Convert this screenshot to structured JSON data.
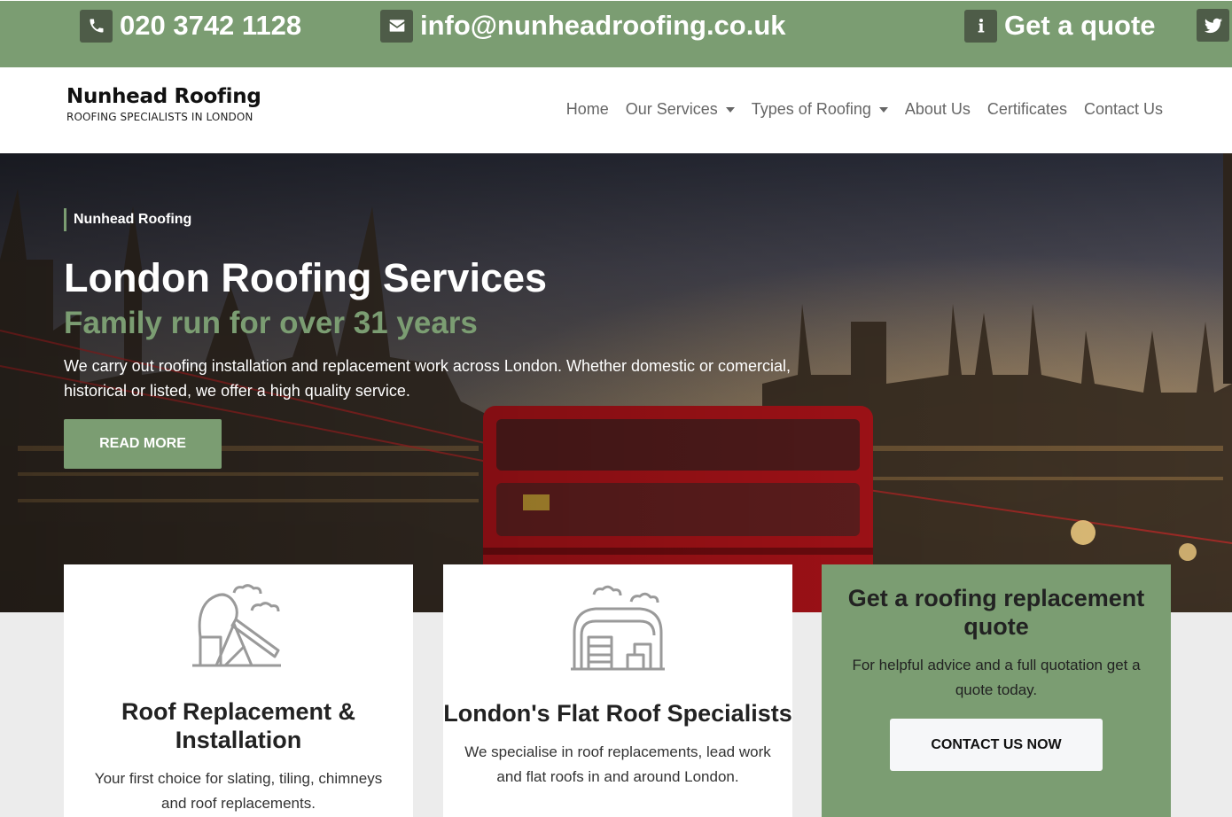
{
  "topbar": {
    "phone": "020 3742 1128",
    "email": "info@nunheadroofing.co.uk",
    "quote": "Get a quote",
    "icons": [
      "phone-icon",
      "envelope-icon",
      "info-icon",
      "twitter-icon"
    ]
  },
  "brand": {
    "name": "Nunhead Roofing",
    "tagline": "ROOFING SPECIALISTS IN LONDON"
  },
  "nav": {
    "home": "Home",
    "services": "Our Services",
    "types": "Types of Roofing",
    "about": "About Us",
    "certificates": "Certificates",
    "contact": "Contact Us"
  },
  "hero": {
    "eyebrow": "Nunhead Roofing",
    "title": "London Roofing Services",
    "subtitle": "Family run for over 31 years",
    "text": "We carry out roofing installation and replacement work across London. Whether domestic or comercial, historical or listed, we offer a high quality service.",
    "button": "READ MORE"
  },
  "cards": [
    {
      "title": "Roof Replacement & Installation",
      "text": "Your first choice for slating, tiling, chimneys and roof replacements.",
      "icon": "pumpjack-icon"
    },
    {
      "title": "London's Flat Roof Specialists",
      "text": "We specialise in roof replacements, lead work and flat roofs in and around London.",
      "icon": "barn-icon"
    }
  ],
  "quote_card": {
    "title": "Get a roofing replacement quote",
    "text": "For helpful advice and a full quotation get a quote today.",
    "button": "CONTACT US NOW"
  },
  "colors": {
    "accent": "#7b9d72",
    "icon_bg": "#4e5c48",
    "nav_text": "#666666"
  }
}
